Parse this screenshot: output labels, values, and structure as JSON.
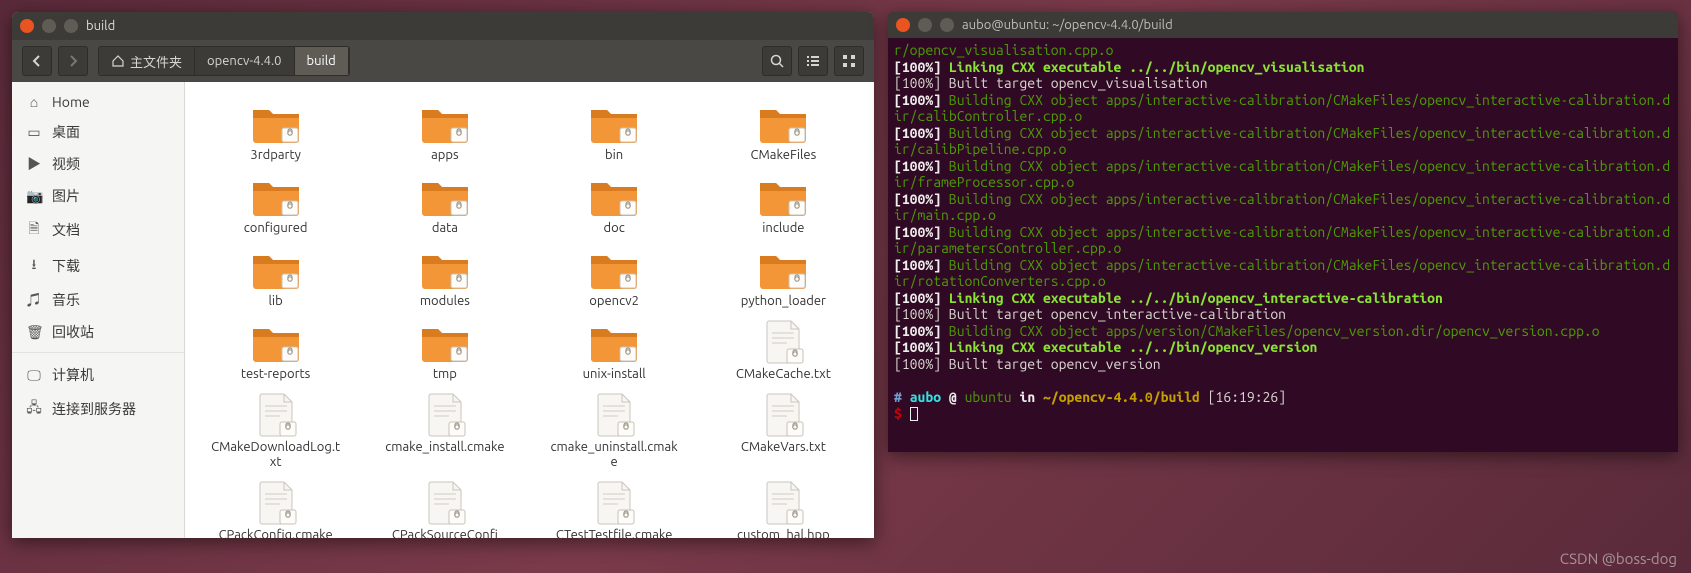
{
  "watermark": "CSDN @boss-dog",
  "fm": {
    "title": "build",
    "path": {
      "home": "主文件夹",
      "seg1": "opencv-4.4.0",
      "seg2": "build"
    },
    "sidebar": [
      {
        "icon": "⌂",
        "label": "Home"
      },
      {
        "icon": "▭",
        "label": "桌面"
      },
      {
        "icon": "▶",
        "label": "视频"
      },
      {
        "icon": "📷",
        "label": "图片"
      },
      {
        "icon": "🗎",
        "label": "文档"
      },
      {
        "icon": "⭳",
        "label": "下载"
      },
      {
        "icon": "♫",
        "label": "音乐"
      },
      {
        "icon": "🗑",
        "label": "回收站"
      },
      {
        "icon": "🖵",
        "label": "计算机"
      },
      {
        "icon": "🖧",
        "label": "连接到服务器"
      }
    ],
    "items": [
      {
        "type": "folder",
        "name": "3rdparty"
      },
      {
        "type": "folder",
        "name": "apps"
      },
      {
        "type": "folder",
        "name": "bin"
      },
      {
        "type": "folder",
        "name": "CMakeFiles"
      },
      {
        "type": "folder",
        "name": "configured"
      },
      {
        "type": "folder",
        "name": "data"
      },
      {
        "type": "folder",
        "name": "doc"
      },
      {
        "type": "folder",
        "name": "include"
      },
      {
        "type": "folder",
        "name": "lib"
      },
      {
        "type": "folder",
        "name": "modules"
      },
      {
        "type": "folder",
        "name": "opencv2"
      },
      {
        "type": "folder",
        "name": "python_loader"
      },
      {
        "type": "folder",
        "name": "test-reports"
      },
      {
        "type": "folder",
        "name": "tmp"
      },
      {
        "type": "folder",
        "name": "unix-install"
      },
      {
        "type": "file",
        "name": "CMakeCache.txt"
      },
      {
        "type": "file",
        "name": "CMakeDownloadLog.txt"
      },
      {
        "type": "file",
        "name": "cmake_install.cmake"
      },
      {
        "type": "file",
        "name": "cmake_uninstall.cmake"
      },
      {
        "type": "file",
        "name": "CMakeVars.txt"
      },
      {
        "type": "file",
        "name": "CPackConfig.cmake"
      },
      {
        "type": "file",
        "name": "CPackSourceConfi"
      },
      {
        "type": "file",
        "name": "CTestTestfile.cmake"
      },
      {
        "type": "file",
        "name": "custom_hal.hpp"
      }
    ]
  },
  "term": {
    "title": "aubo@ubuntu: ~/opencv-4.4.0/build",
    "lines": [
      {
        "t": "cont",
        "txt": "r/opencv_visualisation.cpp.o"
      },
      {
        "t": "link",
        "pct": "[100%]",
        "txt": "Linking CXX executable ../../bin/opencv_visualisation"
      },
      {
        "t": "built",
        "pct": "[100%]",
        "txt": "Built target opencv_visualisation"
      },
      {
        "t": "build",
        "pct": "[100%]",
        "txt": "Building CXX object apps/interactive-calibration/CMakeFiles/opencv_interactive-calibration.dir/calibController.cpp.o"
      },
      {
        "t": "build",
        "pct": "[100%]",
        "txt": "Building CXX object apps/interactive-calibration/CMakeFiles/opencv_interactive-calibration.dir/calibPipeline.cpp.o"
      },
      {
        "t": "build",
        "pct": "[100%]",
        "txt": "Building CXX object apps/interactive-calibration/CMakeFiles/opencv_interactive-calibration.dir/frameProcessor.cpp.o"
      },
      {
        "t": "build",
        "pct": "[100%]",
        "txt": "Building CXX object apps/interactive-calibration/CMakeFiles/opencv_interactive-calibration.dir/main.cpp.o"
      },
      {
        "t": "build",
        "pct": "[100%]",
        "txt": "Building CXX object apps/interactive-calibration/CMakeFiles/opencv_interactive-calibration.dir/parametersController.cpp.o"
      },
      {
        "t": "build",
        "pct": "[100%]",
        "txt": "Building CXX object apps/interactive-calibration/CMakeFiles/opencv_interactive-calibration.dir/rotationConverters.cpp.o"
      },
      {
        "t": "link",
        "pct": "[100%]",
        "txt": "Linking CXX executable ../../bin/opencv_interactive-calibration"
      },
      {
        "t": "built",
        "pct": "[100%]",
        "txt": "Built target opencv_interactive-calibration"
      },
      {
        "t": "build",
        "pct": "[100%]",
        "txt": "Building CXX object apps/version/CMakeFiles/opencv_version.dir/opencv_version.cpp.o"
      },
      {
        "t": "link",
        "pct": "[100%]",
        "txt": "Linking CXX executable ../../bin/opencv_version"
      },
      {
        "t": "built",
        "pct": "[100%]",
        "txt": "Built target opencv_version"
      }
    ],
    "prompt": {
      "hash": "#",
      "user": "aubo",
      "at": "@",
      "host": "ubuntu",
      "in": "in",
      "path": "~/opencv-4.4.0/build",
      "time": "[16:19:26]",
      "dollar": "$"
    }
  }
}
